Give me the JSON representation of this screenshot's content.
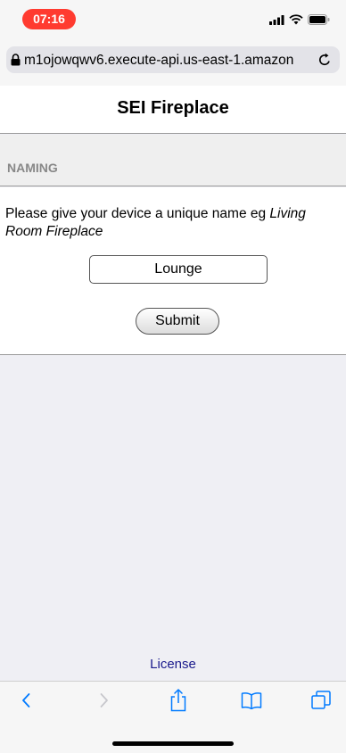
{
  "status_bar": {
    "time": "07:16",
    "icons": [
      "cellular-signal-icon",
      "wifi-icon",
      "battery-icon"
    ]
  },
  "address_bar": {
    "url": "m1ojowqwv6.execute-api.us-east-1.amazon",
    "icons": [
      "lock-icon",
      "reload-icon"
    ]
  },
  "page": {
    "title": "SEI Fireplace",
    "section": "NAMING",
    "instructions_prefix": "Please give your device a unique name eg ",
    "instructions_example": "Living Room Fireplace",
    "name_field_value": "Lounge",
    "submit_label": "Submit",
    "license_label": "License"
  },
  "toolbar": {
    "buttons": [
      "back-icon",
      "forward-icon",
      "share-icon",
      "bookmarks-icon",
      "tabs-icon"
    ]
  },
  "colors": {
    "time_pill": "#ff3b30",
    "ios_blue": "#007aff",
    "link": "#1a1a8c",
    "section_text": "#888888"
  }
}
